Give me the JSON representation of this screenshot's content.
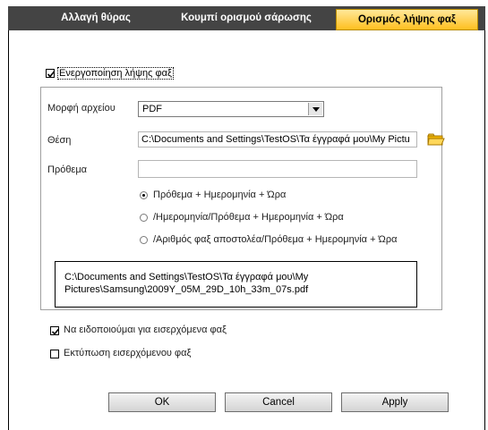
{
  "tabs": [
    {
      "label": "Αλλαγή θύρας"
    },
    {
      "label": "Κουμπί ορισμού σάρωσης"
    },
    {
      "label": "Ορισμός λήψης φαξ"
    }
  ],
  "enable_fax_receive": {
    "label": "Ενεργοποίηση λήψης φαξ",
    "checked": true
  },
  "file_format": {
    "label": "Μορφή αρχείου",
    "value": "PDF"
  },
  "location": {
    "label": "Θέση",
    "value": "C:\\Documents and Settings\\TestOS\\Τα έγγραφά μου\\My Pictu",
    "icon": "folder-icon"
  },
  "prefix": {
    "label": "Πρόθεμα",
    "value": ""
  },
  "naming_options": [
    {
      "label": "Πρόθεμα + Ημερομηνία + Ώρα",
      "selected": true
    },
    {
      "label": "/Ημερομηνία/Πρόθεμα + Ημερομηνία + Ώρα",
      "selected": false
    },
    {
      "label": "/Αριθμός φαξ αποστολέα/Πρόθεμα + Ημερομηνία + Ώρα",
      "selected": false
    }
  ],
  "path_preview": {
    "line1": "C:\\Documents and Settings\\TestOS\\Τα έγγραφά μου\\My",
    "line2": "Pictures\\Samsung\\2009Y_05M_29D_10h_33m_07s.pdf"
  },
  "notify_incoming": {
    "label": "Να ειδοποιούμαι για εισερχόμενα φαξ",
    "checked": true
  },
  "print_incoming": {
    "label": "Εκτύπωση εισερχόμενου φαξ",
    "checked": false
  },
  "buttons": {
    "ok": "OK",
    "cancel": "Cancel",
    "apply": "Apply"
  },
  "colors": {
    "tab_bar": "#444444",
    "active_tab": "#ffc93a",
    "folder": "#f0b400"
  }
}
